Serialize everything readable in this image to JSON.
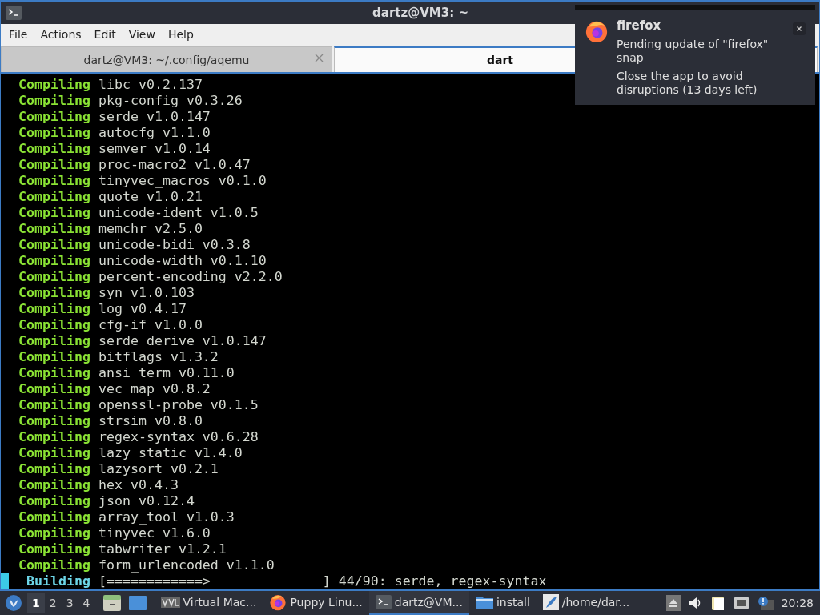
{
  "window": {
    "title": "dartz@VM3: ~"
  },
  "menu": [
    "File",
    "Actions",
    "Edit",
    "View",
    "Help"
  ],
  "tabs": [
    {
      "label": "dartz@VM3: ~/.config/aqemu",
      "selected": false,
      "closable": true
    },
    {
      "label": "dart",
      "selected": true,
      "closable": false
    }
  ],
  "terminal_lines": [
    {
      "kind": "compiling",
      "status": "Compiling",
      "text": "libc v0.2.137"
    },
    {
      "kind": "compiling",
      "status": "Compiling",
      "text": "pkg-config v0.3.26"
    },
    {
      "kind": "compiling",
      "status": "Compiling",
      "text": "serde v1.0.147"
    },
    {
      "kind": "compiling",
      "status": "Compiling",
      "text": "autocfg v1.1.0"
    },
    {
      "kind": "compiling",
      "status": "Compiling",
      "text": "semver v1.0.14"
    },
    {
      "kind": "compiling",
      "status": "Compiling",
      "text": "proc-macro2 v1.0.47"
    },
    {
      "kind": "compiling",
      "status": "Compiling",
      "text": "tinyvec_macros v0.1.0"
    },
    {
      "kind": "compiling",
      "status": "Compiling",
      "text": "quote v1.0.21"
    },
    {
      "kind": "compiling",
      "status": "Compiling",
      "text": "unicode-ident v1.0.5"
    },
    {
      "kind": "compiling",
      "status": "Compiling",
      "text": "memchr v2.5.0"
    },
    {
      "kind": "compiling",
      "status": "Compiling",
      "text": "unicode-bidi v0.3.8"
    },
    {
      "kind": "compiling",
      "status": "Compiling",
      "text": "unicode-width v0.1.10"
    },
    {
      "kind": "compiling",
      "status": "Compiling",
      "text": "percent-encoding v2.2.0"
    },
    {
      "kind": "compiling",
      "status": "Compiling",
      "text": "syn v1.0.103"
    },
    {
      "kind": "compiling",
      "status": "Compiling",
      "text": "log v0.4.17"
    },
    {
      "kind": "compiling",
      "status": "Compiling",
      "text": "cfg-if v1.0.0"
    },
    {
      "kind": "compiling",
      "status": "Compiling",
      "text": "serde_derive v1.0.147"
    },
    {
      "kind": "compiling",
      "status": "Compiling",
      "text": "bitflags v1.3.2"
    },
    {
      "kind": "compiling",
      "status": "Compiling",
      "text": "ansi_term v0.11.0"
    },
    {
      "kind": "compiling",
      "status": "Compiling",
      "text": "vec_map v0.8.2"
    },
    {
      "kind": "compiling",
      "status": "Compiling",
      "text": "openssl-probe v0.1.5"
    },
    {
      "kind": "compiling",
      "status": "Compiling",
      "text": "strsim v0.8.0"
    },
    {
      "kind": "compiling",
      "status": "Compiling",
      "text": "regex-syntax v0.6.28"
    },
    {
      "kind": "compiling",
      "status": "Compiling",
      "text": "lazy_static v1.4.0"
    },
    {
      "kind": "compiling",
      "status": "Compiling",
      "text": "lazysort v0.2.1"
    },
    {
      "kind": "compiling",
      "status": "Compiling",
      "text": "hex v0.4.3"
    },
    {
      "kind": "compiling",
      "status": "Compiling",
      "text": "json v0.12.4"
    },
    {
      "kind": "compiling",
      "status": "Compiling",
      "text": "array_tool v1.0.3"
    },
    {
      "kind": "compiling",
      "status": "Compiling",
      "text": "tinyvec v1.6.0"
    },
    {
      "kind": "compiling",
      "status": "Compiling",
      "text": "tabwriter v1.2.1"
    },
    {
      "kind": "compiling",
      "status": "Compiling",
      "text": "form_urlencoded v1.1.0"
    },
    {
      "kind": "building",
      "status": "Building",
      "text": "[============>              ] 44/90: serde, regex-syntax"
    }
  ],
  "notification": {
    "app": "firefox",
    "body": "Pending update of \"firefox\" snap",
    "detail": "Close the app to avoid disruptions (13 days left)"
  },
  "taskbar": {
    "workspaces": [
      {
        "label": "1",
        "selected": true
      },
      {
        "label": "2",
        "selected": false
      },
      {
        "label": "3",
        "selected": false
      },
      {
        "label": "4",
        "selected": false
      }
    ],
    "tasks": [
      {
        "kind": "vm",
        "label": "Virtual Mac...",
        "selected": false
      },
      {
        "kind": "browser",
        "label": "Puppy Linu...",
        "selected": false
      },
      {
        "kind": "terminal",
        "label": "dartz@VM...",
        "selected": true
      },
      {
        "kind": "folder",
        "label": "install",
        "selected": false
      },
      {
        "kind": "editor",
        "label": "/home/dar...",
        "selected": false
      }
    ],
    "clock": "20:28"
  }
}
